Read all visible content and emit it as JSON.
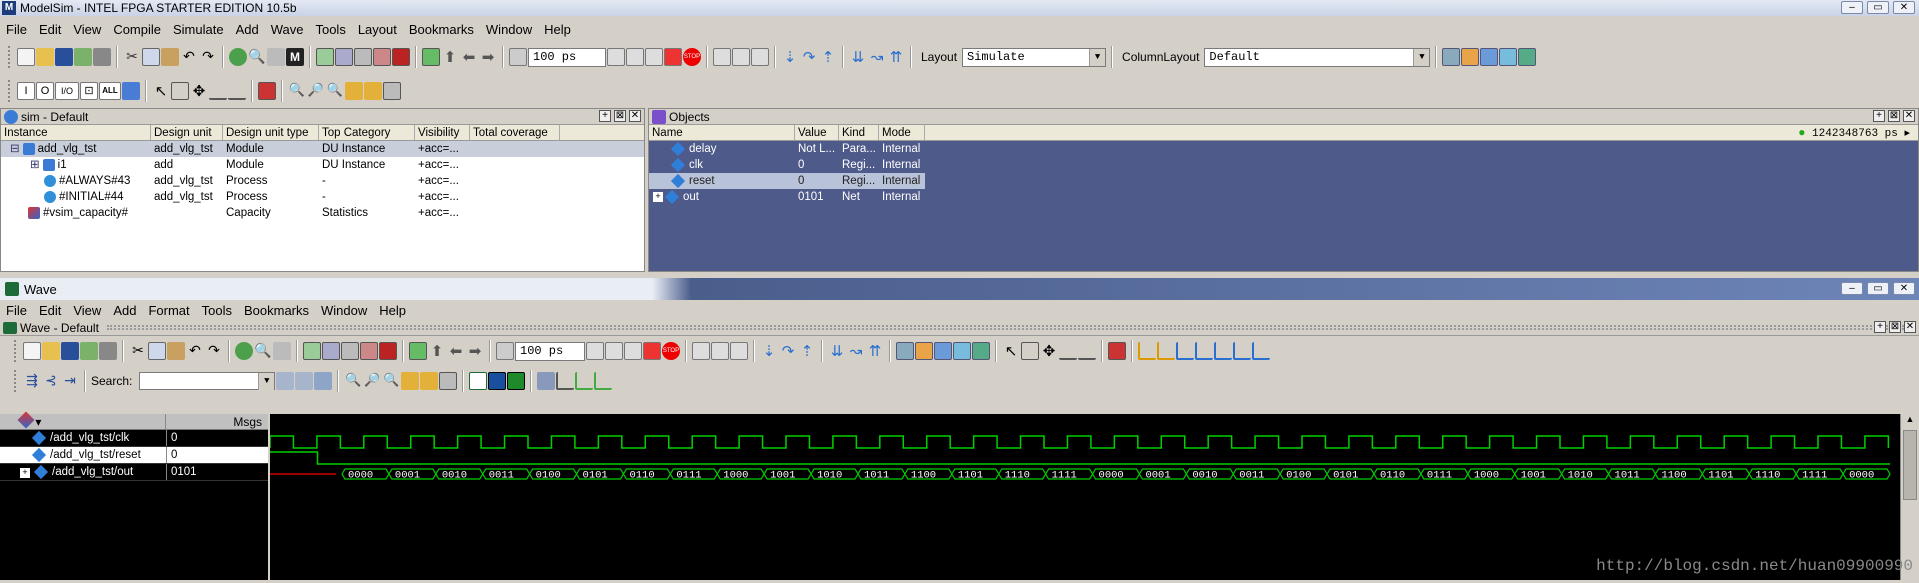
{
  "app": {
    "title": "ModelSim - INTEL FPGA STARTER EDITION 10.5b",
    "menu": [
      "File",
      "Edit",
      "View",
      "Compile",
      "Simulate",
      "Add",
      "Wave",
      "Tools",
      "Layout",
      "Bookmarks",
      "Window",
      "Help"
    ],
    "toolbar": {
      "step_value": "100 ps",
      "layout_label": "Layout",
      "layout_value": "Simulate",
      "columnlayout_label": "ColumnLayout",
      "columnlayout_value": "Default",
      "buttons": [
        "I",
        "O",
        "I/O",
        "ALL"
      ]
    }
  },
  "sim_pane": {
    "title": "sim - Default",
    "columns": [
      "Instance",
      "Design unit",
      "Design unit type",
      "Top Category",
      "Visibility",
      "Total coverage"
    ],
    "rows": [
      {
        "instance": "add_vlg_tst",
        "design_unit": "add_vlg_tst",
        "type": "Module",
        "category": "DU Instance",
        "visibility": "+acc=...",
        "coverage": ""
      },
      {
        "instance": "i1",
        "design_unit": "add",
        "type": "Module",
        "category": "DU Instance",
        "visibility": "+acc=...",
        "coverage": ""
      },
      {
        "instance": "#ALWAYS#43",
        "design_unit": "add_vlg_tst",
        "type": "Process",
        "category": "-",
        "visibility": "+acc=...",
        "coverage": ""
      },
      {
        "instance": "#INITIAL#44",
        "design_unit": "add_vlg_tst",
        "type": "Process",
        "category": "-",
        "visibility": "+acc=...",
        "coverage": ""
      },
      {
        "instance": "#vsim_capacity#",
        "design_unit": "",
        "type": "Capacity",
        "category": "Statistics",
        "visibility": "+acc=...",
        "coverage": ""
      }
    ]
  },
  "objects_pane": {
    "title": "Objects",
    "columns": [
      "Name",
      "Value",
      "Kind",
      "Mode"
    ],
    "time_readout": "1242348763 ps",
    "rows": [
      {
        "name": "delay",
        "value": "Not L...",
        "kind": "Para...",
        "mode": "Internal"
      },
      {
        "name": "clk",
        "value": "0",
        "kind": "Regi...",
        "mode": "Internal"
      },
      {
        "name": "reset",
        "value": "0",
        "kind": "Regi...",
        "mode": "Internal"
      },
      {
        "name": "out",
        "value": "0101",
        "kind": "Net",
        "mode": "Internal"
      }
    ]
  },
  "wave_window": {
    "title": "Wave",
    "menu": [
      "File",
      "Edit",
      "View",
      "Add",
      "Format",
      "Tools",
      "Bookmarks",
      "Window",
      "Help"
    ],
    "pane_title": "Wave - Default",
    "step_value": "100 ps",
    "search_label": "Search:",
    "search_value": "",
    "msgs_label": "Msgs",
    "signals": [
      {
        "name": "/add_vlg_tst/clk",
        "value": "0"
      },
      {
        "name": "/add_vlg_tst/reset",
        "value": "0"
      },
      {
        "name": "/add_vlg_tst/out",
        "value": "0101"
      }
    ],
    "out_values": [
      "0000",
      "0001",
      "0010",
      "0011",
      "0100",
      "0101",
      "0110",
      "0111",
      "1000",
      "1001",
      "1010",
      "1011",
      "1100",
      "1101",
      "1110",
      "1111",
      "0000",
      "0001",
      "0010",
      "0011",
      "0100",
      "0101",
      "0110",
      "0111",
      "1000",
      "1001",
      "1010",
      "1011",
      "1100",
      "1101",
      "1110",
      "1111",
      "0000"
    ],
    "clock_color": "#00d000",
    "bus_color": "#00d000",
    "reset_undefined_color": "#d00000"
  },
  "watermark": "http://blog.csdn.net/huan09900990"
}
